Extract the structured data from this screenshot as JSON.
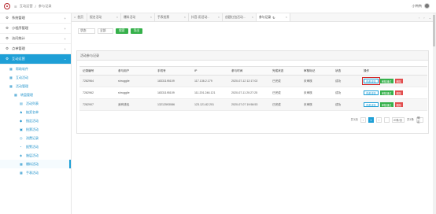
{
  "header": {
    "breadcrumb": [
      "互动运营",
      "参与记录"
    ],
    "username": "小鸭鸭"
  },
  "sidebar": {
    "items": [
      {
        "label": "系统管理",
        "icon": "gear-icon"
      },
      {
        "label": "小程序管理",
        "icon": "gear-icon"
      },
      {
        "label": "访问统计",
        "icon": "gear-icon"
      },
      {
        "label": "点单管理",
        "icon": "gear-icon"
      },
      {
        "label": "互动运营",
        "icon": "gear-icon",
        "active": true
      }
    ],
    "subs": [
      {
        "label": "帮助软件",
        "level": 1
      },
      {
        "label": "互动活动",
        "level": 1
      },
      {
        "label": "活动管理",
        "level": 1
      },
      {
        "label": "转盘管理",
        "level": 2
      },
      {
        "label": "活动列表",
        "level": 3
      },
      {
        "label": "抽奖名单",
        "level": 3
      },
      {
        "label": "指定活动",
        "level": 3
      },
      {
        "label": "抢票活动",
        "level": 3
      },
      {
        "label": "消费记录",
        "level": 3
      },
      {
        "label": "报警活动",
        "level": 3
      },
      {
        "label": "施层活动",
        "level": 3
      },
      {
        "label": "爆料活动",
        "level": 3,
        "current": true
      },
      {
        "label": "手表活动",
        "level": 3
      }
    ]
  },
  "tabs": [
    {
      "label": "首页",
      "home": true
    },
    {
      "label": "报名活动"
    },
    {
      "label": "爆料活动"
    },
    {
      "label": "手表抢票"
    },
    {
      "label": "抖音-用活动..."
    },
    {
      "label": "创建红包活动..."
    },
    {
      "label": "参与记录",
      "active": true
    }
  ],
  "filter": {
    "select1": "状态",
    "select2": "全部",
    "search_label": "搜索",
    "export_label": "导出"
  },
  "panel": {
    "title": "活动参与记录"
  },
  "table": {
    "headers": [
      "记录编号",
      "参与用户",
      "手机号",
      "IP",
      "参与时间",
      "完成状态",
      "审核标记",
      "状态",
      "操作"
    ],
    "rows": [
      [
        "7282964",
        "shrugglie",
        "18331195109",
        "117.136.2.179",
        "2020-07-12 12:17:02",
        "已完成",
        "未审核",
        "成功"
      ],
      [
        "7282962",
        "shrugglie",
        "18331195109",
        "111.201.246.121",
        "2020-07-11 20:27:25",
        "已完成",
        "未审核",
        "成功"
      ],
      [
        "7282907",
        "我有钱包",
        "13212593086",
        "123.121.82.201",
        "2020-07-07 19:58:53",
        "已完成",
        "未审核",
        "成功"
      ]
    ],
    "ops": {
      "view": "查看详情",
      "edit": "审核通过",
      "del": "删除"
    }
  },
  "pagination": {
    "total_pages": "共1页",
    "current": "1",
    "page_size": "20条/页",
    "total": "共1条",
    "go": "确定"
  },
  "colors": {
    "accent": "#1e9fd6",
    "green": "#35b04a",
    "red": "#e24e4e"
  }
}
